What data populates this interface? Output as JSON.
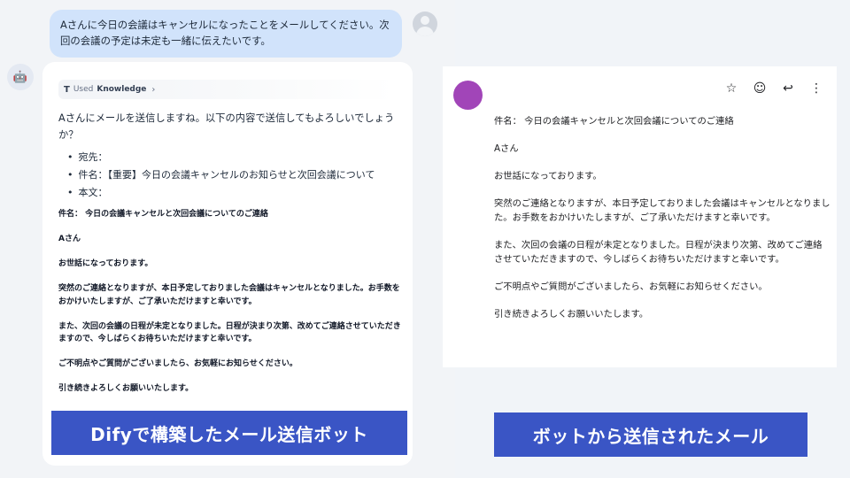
{
  "chat": {
    "user_message": "Aさんに今日の会議はキャンセルになったことをメールしてください。次回の会議の予定は未定も一緒に伝えたいです。",
    "knowledge": {
      "label_prefix": "Used",
      "label_main": "Knowledge",
      "icon": "T",
      "chevron": "›"
    },
    "intro": "Aさんにメールを送信しますね。以下の内容で送信してもよろしいでしょうか？",
    "bullets": [
      "宛先：",
      "件名：【重要】今日の会議キャンセルのお知らせと次回会議について",
      "本文："
    ],
    "mail_paragraphs": [
      "件名： 今日の会議キャンセルと次回会議についてのご連絡",
      "Aさん",
      "お世話になっております。",
      "突然のご連絡となりますが、本日予定しておりました会議はキャンセルとなりました。お手数をおかけいたしますが、ご了承いただけますと幸いです。",
      "また、次回の会議の日程が未定となりました。日程が決まり次第、改めてご連絡させていただきますので、今しばらくお待ちいただけますと幸いです。",
      "ご不明点やご質問がございましたら、お気軽にお知らせください。",
      "引き続きよろしくお願いいたします。"
    ],
    "caption": "Difyで構築したメール送信ボット"
  },
  "mail": {
    "toolbar": {
      "star": "☆",
      "emoji": "☺",
      "reply": "↩",
      "more": "⋮"
    },
    "paragraphs": [
      "件名： 今日の会議キャンセルと次回会議についてのご連絡",
      "Aさん",
      "お世話になっております。",
      "突然のご連絡となりますが、本日予定しておりました会議はキャンセルとなりました。お手数をおかけいたしますが、ご了承いただけますと幸いです。",
      "また、次回の会議の日程が未定となりました。日程が決まり次第、改めてご連絡させていただきますので、今しばらくお待ちいただけますと幸いです。",
      "ご不明点やご質問がございましたら、お気軽にお知らせください。",
      "引き続きよろしくお願いいたします。"
    ],
    "caption": "ボットから送信されたメール"
  },
  "colors": {
    "caption_bg": "#3a55c5",
    "sender_avatar": "#a145b8",
    "user_bubble": "#d1e3fb"
  }
}
